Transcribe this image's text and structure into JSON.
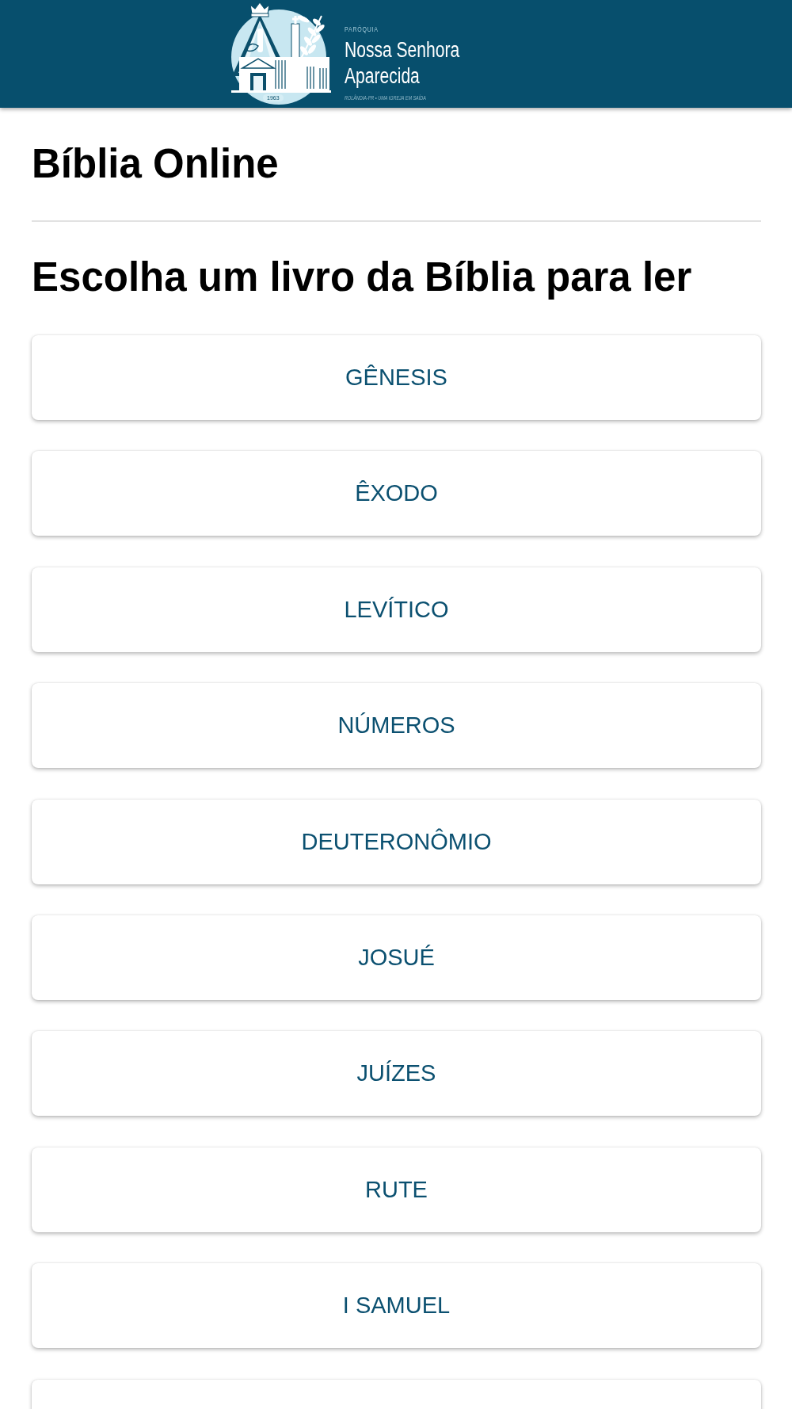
{
  "header": {
    "logo": {
      "small_title": "PARÓQUIA",
      "title_line_1": "Nossa Senhora",
      "title_line_2": "Aparecida",
      "tagline": "ROLÂNDIA-PR • UMA IGREJA EM SAÍDA",
      "year": "1963"
    }
  },
  "page_title": "Bíblia Online",
  "section_heading": "Escolha um livro da Bíblia para ler",
  "books": [
    {
      "label": "GÊNESIS"
    },
    {
      "label": "ÊXODO"
    },
    {
      "label": "LEVÍTICO"
    },
    {
      "label": "NÚMEROS"
    },
    {
      "label": "DEUTERONÔMIO"
    },
    {
      "label": "JOSUÉ"
    },
    {
      "label": "JUÍZES"
    },
    {
      "label": "RUTE"
    },
    {
      "label": "I SAMUEL"
    }
  ],
  "list_continues": true
}
